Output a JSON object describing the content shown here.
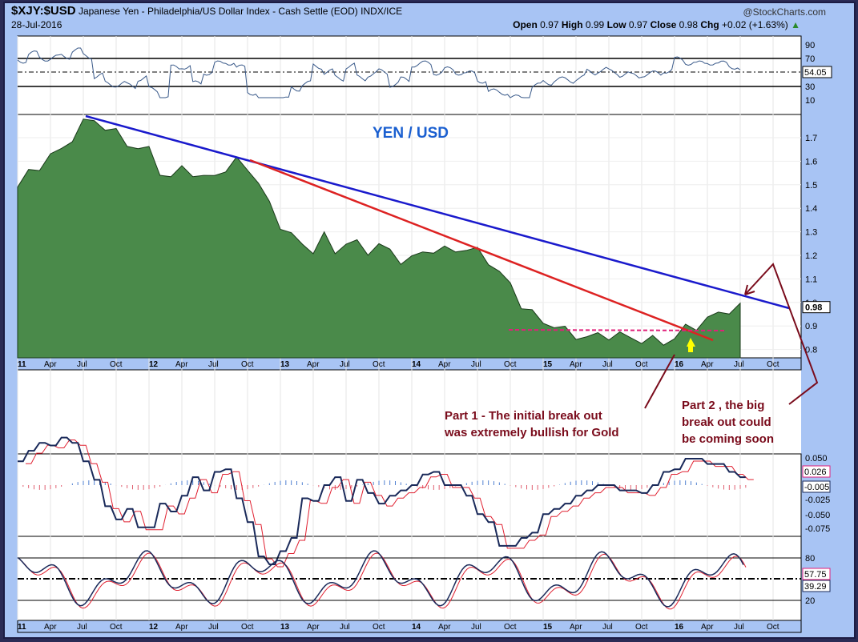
{
  "header": {
    "symbol": "$XJY:$USD",
    "name": "Japanese Yen - Philadelphia/US Dollar Index - Cash Settle (EOD) INDX/ICE",
    "date": "28-Jul-2016",
    "brand": "@StockCharts.com",
    "open_l": "Open",
    "open": "0.97",
    "high_l": "High",
    "high": "0.99",
    "low_l": "Low",
    "low": "0.97",
    "close_l": "Close",
    "close": "0.98",
    "chg_l": "Chg",
    "chg": "+0.02 (+1.63%)"
  },
  "colors": {
    "price_fill": "#4a8a4a",
    "trend_blue": "#1a1acc",
    "trend_red": "#dd2222",
    "annot": "#7a0c1c",
    "title_blue": "#1a5fd0"
  },
  "chart_data": [
    {
      "type": "area",
      "title": "YEN / USD",
      "ylim": [
        0.75,
        1.85
      ],
      "yticks": [
        "1.7",
        "1.6",
        "1.5",
        "1.4",
        "1.3",
        "1.2",
        "1.1",
        "1.0",
        "0.9",
        "0.8"
      ],
      "last_label": "0.98",
      "x_start": "Jan 2011",
      "x_step": "month",
      "values": [
        1.49,
        1.55,
        1.58,
        1.62,
        1.65,
        1.7,
        1.76,
        1.78,
        1.74,
        1.72,
        1.68,
        1.65,
        1.65,
        1.56,
        1.52,
        1.58,
        1.55,
        1.52,
        1.55,
        1.56,
        1.6,
        1.58,
        1.5,
        1.42,
        1.33,
        1.28,
        1.25,
        1.22,
        1.28,
        1.22,
        1.25,
        1.25,
        1.22,
        1.24,
        1.22,
        1.18,
        1.18,
        1.22,
        1.22,
        1.22,
        1.23,
        1.22,
        1.22,
        1.18,
        1.12,
        1.08,
        0.99,
        0.95,
        0.92,
        0.9,
        0.88,
        0.86,
        0.85,
        0.86,
        0.86,
        0.86,
        0.85,
        0.84,
        0.84,
        0.83,
        0.85,
        0.89,
        0.9,
        0.93,
        0.95,
        0.97,
        0.98
      ]
    },
    {
      "type": "line",
      "name": "RSI",
      "yticks": [
        "90",
        "70",
        "30",
        "10"
      ],
      "last_label": "54.05"
    },
    {
      "type": "line",
      "name": "MACD",
      "yticks": [
        "0.050",
        "-0.025",
        "-0.050",
        "-0.075"
      ],
      "labels": [
        "0.026",
        "-0.005"
      ]
    },
    {
      "type": "line",
      "name": "Stochastic",
      "yticks": [
        "80",
        "20"
      ],
      "labels": [
        "57.75",
        "39.29"
      ]
    }
  ],
  "xaxis": [
    "11",
    "Apr",
    "Jul",
    "Oct",
    "12",
    "Apr",
    "Jul",
    "Oct",
    "13",
    "Apr",
    "Jul",
    "Oct",
    "14",
    "Apr",
    "Jul",
    "Oct",
    "15",
    "Apr",
    "Jul",
    "Oct",
    "16",
    "Apr",
    "Jul",
    "Oct"
  ],
  "annotations": {
    "part1": [
      "Part 1 - The initial break out",
      "was extremely bullish for Gold"
    ],
    "part2": [
      "Part 2 , the big",
      "break out could",
      "be coming soon"
    ]
  }
}
